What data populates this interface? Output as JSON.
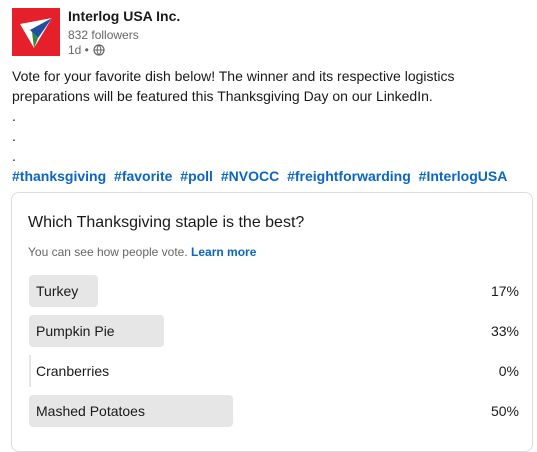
{
  "post": {
    "company": "Interlog USA Inc.",
    "followers": "832 followers",
    "time": "1d •",
    "text_line1": "Vote for your favorite dish below! The winner and its respective logistics",
    "text_line2": "preparations will be featured this Thanksgiving Day on our LinkedIn.",
    "dots": [
      ".",
      ".",
      "."
    ],
    "hashtags": [
      "#thanksgiving",
      "#favorite",
      "#poll",
      "#NVOCC",
      "#freightforwarding",
      "#InterlogUSA"
    ],
    "icons": {
      "logo": "paper-plane-logo-icon",
      "visibility": "globe-icon"
    },
    "colors": {
      "logo_bg": "#e5202a",
      "link": "#0a66c2",
      "bar": "#e6e6e6"
    }
  },
  "poll": {
    "question": "Which Thanksgiving staple is the best?",
    "note": "You can see how people vote.",
    "learn_more": "Learn more",
    "options": [
      {
        "label": "Turkey",
        "percent_text": "17%",
        "value": 17
      },
      {
        "label": "Pumpkin Pie",
        "percent_text": "33%",
        "value": 33
      },
      {
        "label": "Cranberries",
        "percent_text": "0%",
        "value": 0
      },
      {
        "label": "Mashed Potatoes",
        "percent_text": "50%",
        "value": 50
      }
    ]
  }
}
